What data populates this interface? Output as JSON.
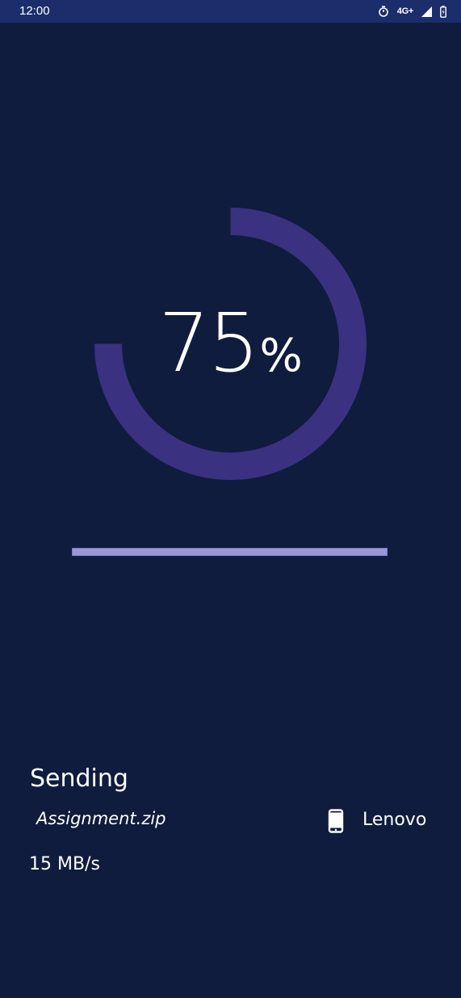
{
  "status_bar": {
    "time": "12:00",
    "network": "4G+",
    "icons": [
      "alarm-icon",
      "network-4g-plus-icon",
      "signal-icon",
      "battery-icon"
    ]
  },
  "transfer": {
    "progress_percent": 75,
    "percent_value": "75",
    "percent_sign": "%",
    "linear_progress_fraction": 1.0,
    "status_label": "Sending",
    "file_name": "Assignment.zip",
    "device_icon": "phone-icon",
    "device_name": "Lenovo",
    "speed": "15 MB/s"
  },
  "colors": {
    "background": "#0f1c3d",
    "status_bar": "#1b2e6b",
    "ring": "#3a3180",
    "linear_fill": "#9a97d9",
    "text": "#ffffff"
  }
}
